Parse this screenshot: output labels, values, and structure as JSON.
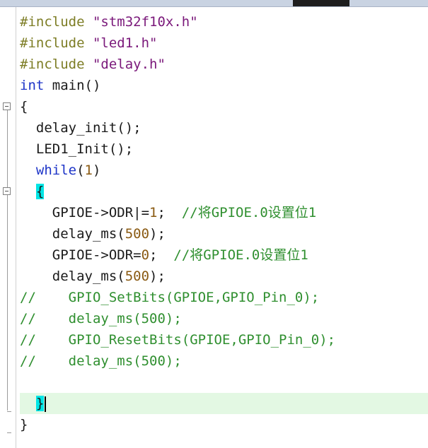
{
  "editor": {
    "lines": [
      [
        {
          "c": "pp",
          "t": "#include "
        },
        {
          "c": "str",
          "t": "\"stm32f10x.h\""
        }
      ],
      [
        {
          "c": "pp",
          "t": "#include "
        },
        {
          "c": "str",
          "t": "\"led1.h\""
        }
      ],
      [
        {
          "c": "pp",
          "t": "#include "
        },
        {
          "c": "str",
          "t": "\"delay.h\""
        }
      ],
      [
        {
          "c": "kw",
          "t": "int"
        },
        {
          "c": "",
          "t": " main()"
        }
      ],
      [
        {
          "c": "",
          "t": "{"
        }
      ],
      [
        {
          "c": "",
          "t": "  delay_init();"
        }
      ],
      [
        {
          "c": "",
          "t": "  LED1_Init();"
        }
      ],
      [
        {
          "c": "",
          "t": "  "
        },
        {
          "c": "kw",
          "t": "while"
        },
        {
          "c": "",
          "t": "("
        },
        {
          "c": "num",
          "t": "1"
        },
        {
          "c": "",
          "t": ")"
        }
      ],
      [
        {
          "c": "",
          "t": "  "
        },
        {
          "c": "brace-match",
          "t": "{"
        }
      ],
      [
        {
          "c": "",
          "t": "    GPIOE->ODR|="
        },
        {
          "c": "num",
          "t": "1"
        },
        {
          "c": "",
          "t": ";  "
        },
        {
          "c": "cm",
          "t": "//将GPIOE.0设置位1"
        }
      ],
      [
        {
          "c": "",
          "t": "    delay_ms("
        },
        {
          "c": "num",
          "t": "500"
        },
        {
          "c": "",
          "t": ");"
        }
      ],
      [
        {
          "c": "",
          "t": "    GPIOE->ODR="
        },
        {
          "c": "num",
          "t": "0"
        },
        {
          "c": "",
          "t": ";  "
        },
        {
          "c": "cm",
          "t": "//将GPIOE.0设置位1"
        }
      ],
      [
        {
          "c": "",
          "t": "    delay_ms("
        },
        {
          "c": "num",
          "t": "500"
        },
        {
          "c": "",
          "t": ");"
        }
      ],
      [
        {
          "c": "cm",
          "t": "//    GPIO_SetBits(GPIOE,GPIO_Pin_0);"
        }
      ],
      [
        {
          "c": "cm",
          "t": "//    delay_ms(500);"
        }
      ],
      [
        {
          "c": "cm",
          "t": "//    GPIO_ResetBits(GPIOE,GPIO_Pin_0);"
        }
      ],
      [
        {
          "c": "cm",
          "t": "//    delay_ms(500);"
        }
      ],
      [
        {
          "c": "",
          "t": ""
        }
      ],
      [
        {
          "c": "",
          "t": "  "
        },
        {
          "c": "brace-match",
          "t": "}"
        }
      ],
      [
        {
          "c": "",
          "t": "}"
        }
      ]
    ],
    "highlighted_line": 18,
    "caret_line": 18
  }
}
